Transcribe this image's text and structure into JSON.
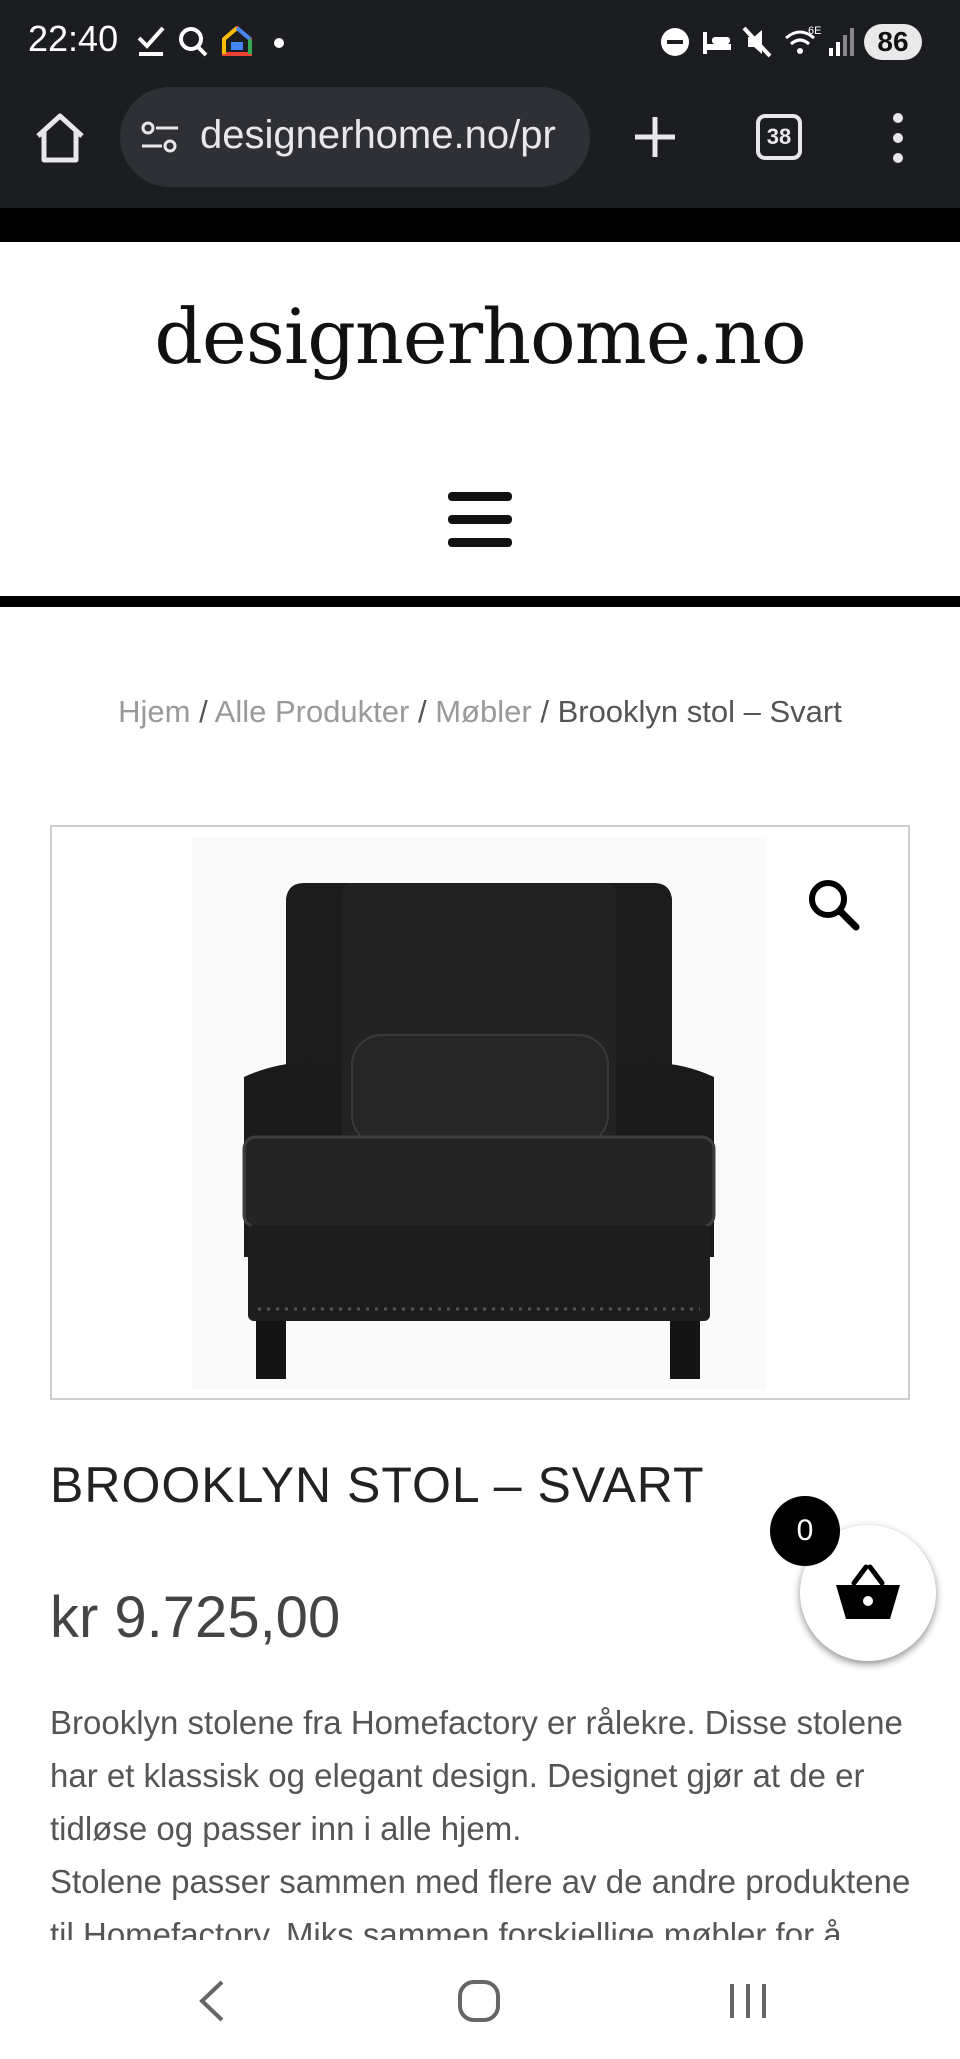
{
  "status_bar": {
    "time": "22:40",
    "battery": "86",
    "notification_icons": [
      "check-icon",
      "search-icon",
      "google-home-icon",
      "dot-icon"
    ],
    "system_icons": [
      "dnd-icon",
      "sleep-icon",
      "mute-icon",
      "wifi-6e-icon",
      "signal-icon"
    ]
  },
  "browser": {
    "url": "designerhome.no/pr",
    "tab_count": "38"
  },
  "site": {
    "logo": "designerhome.no",
    "breadcrumb": {
      "items": [
        "Hjem",
        "Alle Produkter",
        "Møbler"
      ],
      "separator": "/",
      "current": "Brooklyn stol – Svart"
    }
  },
  "product": {
    "title": "BROOKLYN STOL – SVART",
    "price": "kr 9.725,00",
    "description": [
      "Brooklyn stolene fra Homefactory er rålekre. Disse stolene har et klassisk og elegant design. Designet gjør at de er tidløse og passer inn i alle hjem.",
      "Stolene passer sammen med flere av de andre produktene til Homefactory. Miks sammen forskjellige møbler for å"
    ]
  },
  "cart": {
    "count": "0"
  },
  "colors": {
    "chrome_bg": "#1b1d21",
    "urlbar_bg": "#2e3036",
    "page_bg": "#ffffff",
    "text_dark": "#222222",
    "text_muted": "#9a9a9a"
  }
}
